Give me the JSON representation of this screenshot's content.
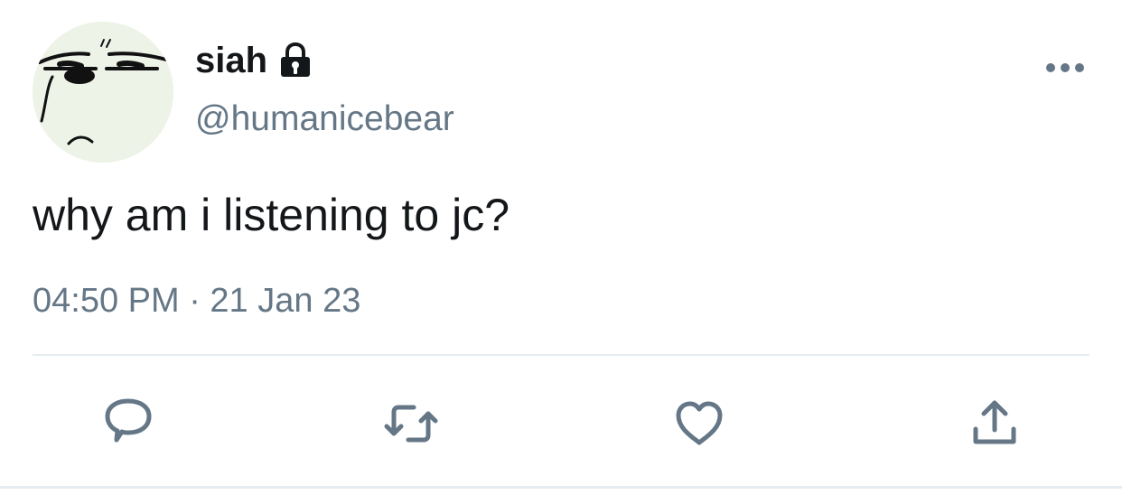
{
  "tweet": {
    "author": {
      "display_name": "siah",
      "handle": "@humanicebear",
      "protected_icon": "lock-icon",
      "avatar_icon": "grumpy-face-avatar"
    },
    "text": "why am i listening to jc?",
    "timestamp": "04:50 PM · 21 Jan 23",
    "actions": [
      {
        "name": "reply",
        "icon": "chat-bubble-icon"
      },
      {
        "name": "retweet",
        "icon": "retweet-icon"
      },
      {
        "name": "like",
        "icon": "heart-icon"
      },
      {
        "name": "share",
        "icon": "share-upload-icon"
      }
    ],
    "colors": {
      "text_primary": "#14171a",
      "text_secondary": "#657786",
      "divider": "#e6ecf0",
      "avatar_background": "#eef3e8"
    }
  }
}
